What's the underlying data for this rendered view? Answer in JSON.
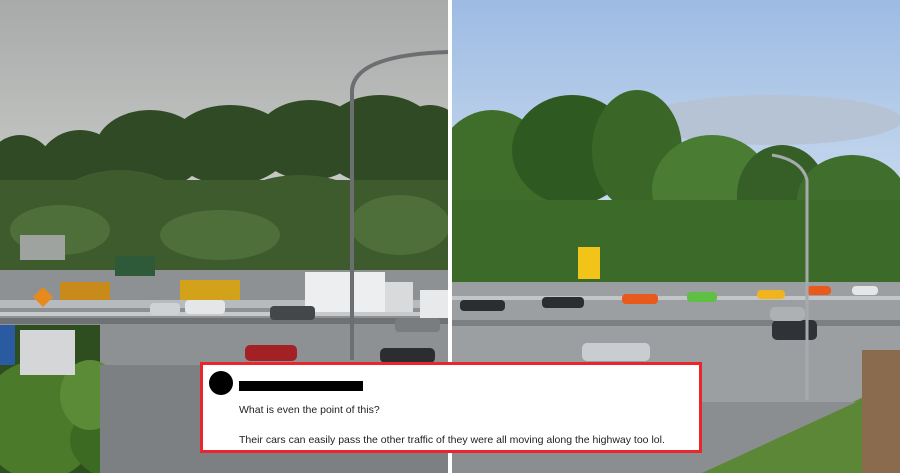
{
  "photos": {
    "left": {
      "label": "photo-left-highway-traffic"
    },
    "right": {
      "label": "photo-right-highway-supercars"
    }
  },
  "car_colors": {
    "orange": "#e8591c",
    "green": "#5fbf45",
    "yellow": "#f0b41c",
    "dark": "#2b2d30",
    "red": "#a32025",
    "silver": "#c9ccd1"
  },
  "comment": {
    "border_color": "#e8262c",
    "author_redacted": true,
    "question": "What is even the point of this?",
    "reply": "Their cars can easily pass the other traffic of they were all moving along the highway too lol."
  }
}
